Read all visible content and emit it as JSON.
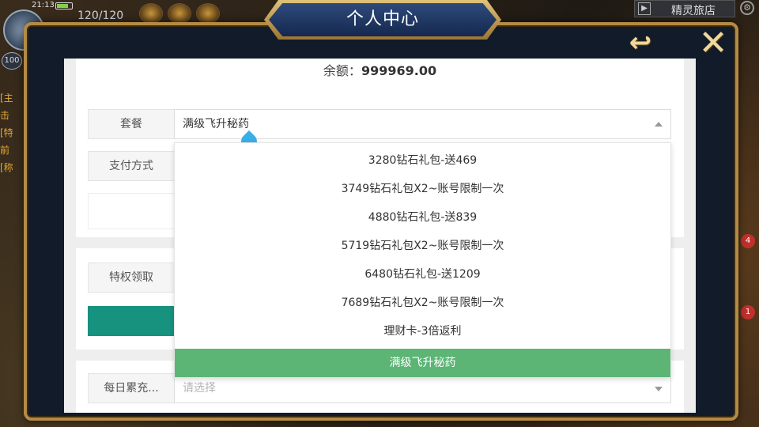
{
  "hud": {
    "time": "21:13",
    "stamina": "120/120",
    "level": "100",
    "shop_label": "精灵旅店",
    "right_badges": [
      "4",
      "1"
    ]
  },
  "modal": {
    "title": "个人中心",
    "back_symbol": "↩",
    "close_symbol": "✕"
  },
  "balance": {
    "label": "余额：",
    "value": "999969.00"
  },
  "form": {
    "package_label": "套餐",
    "package_value": "满级飞升秘药",
    "payment_label": "支付方式",
    "privilege_label": "特权领取",
    "daily_label": "每日累充...",
    "daily_placeholder": "请选择"
  },
  "dropdown": {
    "options": [
      "3280钻石礼包-送469",
      "3749钻石礼包X2~账号限制一次",
      "4880钻石礼包-送839",
      "5719钻石礼包X2~账号限制一次",
      "6480钻石礼包-送1209",
      "7689钻石礼包X2~账号限制一次",
      "理财卡-3倍返利",
      "满级飞升秘药"
    ],
    "selected": "满级飞升秘药"
  },
  "colors": {
    "accent_teal": "#16927e",
    "selected_green": "#5cb575",
    "frame_gold": "#b48b45",
    "banner_blue": "#1e3663"
  }
}
